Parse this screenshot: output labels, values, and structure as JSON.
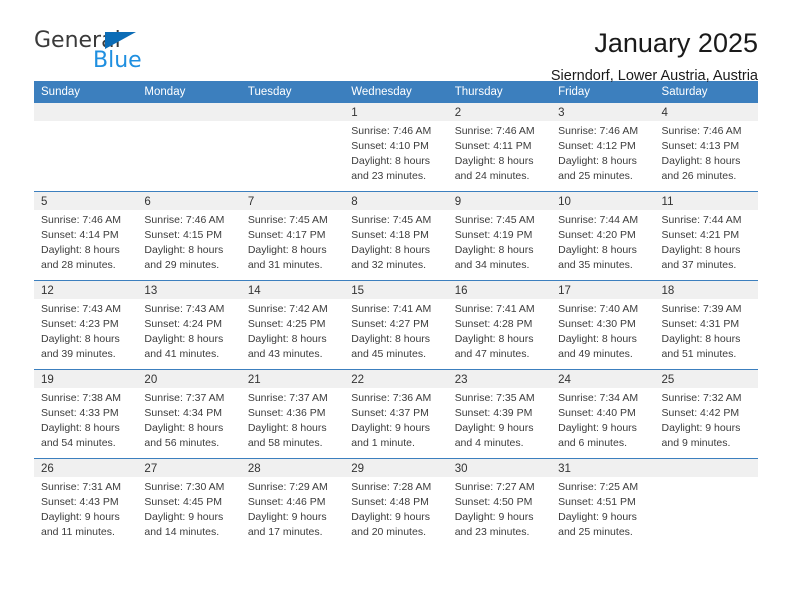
{
  "brand": {
    "name_part1": "General",
    "name_part2": "Blue",
    "accent_color": "#1f8fe0",
    "triangle_color": "#0b6cb6"
  },
  "header": {
    "title": "January 2025",
    "subtitle": "Sierndorf, Lower Austria, Austria"
  },
  "theme": {
    "header_row_bg": "#3c7fbe",
    "daynum_bg": "#f0f0f0"
  },
  "weekday_headers": [
    "Sunday",
    "Monday",
    "Tuesday",
    "Wednesday",
    "Thursday",
    "Friday",
    "Saturday"
  ],
  "weeks": [
    [
      {
        "day": "",
        "sunrise": "",
        "sunset": "",
        "daylight": "",
        "daylight2": ""
      },
      {
        "day": "",
        "sunrise": "",
        "sunset": "",
        "daylight": "",
        "daylight2": ""
      },
      {
        "day": "",
        "sunrise": "",
        "sunset": "",
        "daylight": "",
        "daylight2": ""
      },
      {
        "day": "1",
        "sunrise": "Sunrise: 7:46 AM",
        "sunset": "Sunset: 4:10 PM",
        "daylight": "Daylight: 8 hours",
        "daylight2": "and 23 minutes."
      },
      {
        "day": "2",
        "sunrise": "Sunrise: 7:46 AM",
        "sunset": "Sunset: 4:11 PM",
        "daylight": "Daylight: 8 hours",
        "daylight2": "and 24 minutes."
      },
      {
        "day": "3",
        "sunrise": "Sunrise: 7:46 AM",
        "sunset": "Sunset: 4:12 PM",
        "daylight": "Daylight: 8 hours",
        "daylight2": "and 25 minutes."
      },
      {
        "day": "4",
        "sunrise": "Sunrise: 7:46 AM",
        "sunset": "Sunset: 4:13 PM",
        "daylight": "Daylight: 8 hours",
        "daylight2": "and 26 minutes."
      }
    ],
    [
      {
        "day": "5",
        "sunrise": "Sunrise: 7:46 AM",
        "sunset": "Sunset: 4:14 PM",
        "daylight": "Daylight: 8 hours",
        "daylight2": "and 28 minutes."
      },
      {
        "day": "6",
        "sunrise": "Sunrise: 7:46 AM",
        "sunset": "Sunset: 4:15 PM",
        "daylight": "Daylight: 8 hours",
        "daylight2": "and 29 minutes."
      },
      {
        "day": "7",
        "sunrise": "Sunrise: 7:45 AM",
        "sunset": "Sunset: 4:17 PM",
        "daylight": "Daylight: 8 hours",
        "daylight2": "and 31 minutes."
      },
      {
        "day": "8",
        "sunrise": "Sunrise: 7:45 AM",
        "sunset": "Sunset: 4:18 PM",
        "daylight": "Daylight: 8 hours",
        "daylight2": "and 32 minutes."
      },
      {
        "day": "9",
        "sunrise": "Sunrise: 7:45 AM",
        "sunset": "Sunset: 4:19 PM",
        "daylight": "Daylight: 8 hours",
        "daylight2": "and 34 minutes."
      },
      {
        "day": "10",
        "sunrise": "Sunrise: 7:44 AM",
        "sunset": "Sunset: 4:20 PM",
        "daylight": "Daylight: 8 hours",
        "daylight2": "and 35 minutes."
      },
      {
        "day": "11",
        "sunrise": "Sunrise: 7:44 AM",
        "sunset": "Sunset: 4:21 PM",
        "daylight": "Daylight: 8 hours",
        "daylight2": "and 37 minutes."
      }
    ],
    [
      {
        "day": "12",
        "sunrise": "Sunrise: 7:43 AM",
        "sunset": "Sunset: 4:23 PM",
        "daylight": "Daylight: 8 hours",
        "daylight2": "and 39 minutes."
      },
      {
        "day": "13",
        "sunrise": "Sunrise: 7:43 AM",
        "sunset": "Sunset: 4:24 PM",
        "daylight": "Daylight: 8 hours",
        "daylight2": "and 41 minutes."
      },
      {
        "day": "14",
        "sunrise": "Sunrise: 7:42 AM",
        "sunset": "Sunset: 4:25 PM",
        "daylight": "Daylight: 8 hours",
        "daylight2": "and 43 minutes."
      },
      {
        "day": "15",
        "sunrise": "Sunrise: 7:41 AM",
        "sunset": "Sunset: 4:27 PM",
        "daylight": "Daylight: 8 hours",
        "daylight2": "and 45 minutes."
      },
      {
        "day": "16",
        "sunrise": "Sunrise: 7:41 AM",
        "sunset": "Sunset: 4:28 PM",
        "daylight": "Daylight: 8 hours",
        "daylight2": "and 47 minutes."
      },
      {
        "day": "17",
        "sunrise": "Sunrise: 7:40 AM",
        "sunset": "Sunset: 4:30 PM",
        "daylight": "Daylight: 8 hours",
        "daylight2": "and 49 minutes."
      },
      {
        "day": "18",
        "sunrise": "Sunrise: 7:39 AM",
        "sunset": "Sunset: 4:31 PM",
        "daylight": "Daylight: 8 hours",
        "daylight2": "and 51 minutes."
      }
    ],
    [
      {
        "day": "19",
        "sunrise": "Sunrise: 7:38 AM",
        "sunset": "Sunset: 4:33 PM",
        "daylight": "Daylight: 8 hours",
        "daylight2": "and 54 minutes."
      },
      {
        "day": "20",
        "sunrise": "Sunrise: 7:37 AM",
        "sunset": "Sunset: 4:34 PM",
        "daylight": "Daylight: 8 hours",
        "daylight2": "and 56 minutes."
      },
      {
        "day": "21",
        "sunrise": "Sunrise: 7:37 AM",
        "sunset": "Sunset: 4:36 PM",
        "daylight": "Daylight: 8 hours",
        "daylight2": "and 58 minutes."
      },
      {
        "day": "22",
        "sunrise": "Sunrise: 7:36 AM",
        "sunset": "Sunset: 4:37 PM",
        "daylight": "Daylight: 9 hours",
        "daylight2": "and 1 minute."
      },
      {
        "day": "23",
        "sunrise": "Sunrise: 7:35 AM",
        "sunset": "Sunset: 4:39 PM",
        "daylight": "Daylight: 9 hours",
        "daylight2": "and 4 minutes."
      },
      {
        "day": "24",
        "sunrise": "Sunrise: 7:34 AM",
        "sunset": "Sunset: 4:40 PM",
        "daylight": "Daylight: 9 hours",
        "daylight2": "and 6 minutes."
      },
      {
        "day": "25",
        "sunrise": "Sunrise: 7:32 AM",
        "sunset": "Sunset: 4:42 PM",
        "daylight": "Daylight: 9 hours",
        "daylight2": "and 9 minutes."
      }
    ],
    [
      {
        "day": "26",
        "sunrise": "Sunrise: 7:31 AM",
        "sunset": "Sunset: 4:43 PM",
        "daylight": "Daylight: 9 hours",
        "daylight2": "and 11 minutes."
      },
      {
        "day": "27",
        "sunrise": "Sunrise: 7:30 AM",
        "sunset": "Sunset: 4:45 PM",
        "daylight": "Daylight: 9 hours",
        "daylight2": "and 14 minutes."
      },
      {
        "day": "28",
        "sunrise": "Sunrise: 7:29 AM",
        "sunset": "Sunset: 4:46 PM",
        "daylight": "Daylight: 9 hours",
        "daylight2": "and 17 minutes."
      },
      {
        "day": "29",
        "sunrise": "Sunrise: 7:28 AM",
        "sunset": "Sunset: 4:48 PM",
        "daylight": "Daylight: 9 hours",
        "daylight2": "and 20 minutes."
      },
      {
        "day": "30",
        "sunrise": "Sunrise: 7:27 AM",
        "sunset": "Sunset: 4:50 PM",
        "daylight": "Daylight: 9 hours",
        "daylight2": "and 23 minutes."
      },
      {
        "day": "31",
        "sunrise": "Sunrise: 7:25 AM",
        "sunset": "Sunset: 4:51 PM",
        "daylight": "Daylight: 9 hours",
        "daylight2": "and 25 minutes."
      },
      {
        "day": "",
        "sunrise": "",
        "sunset": "",
        "daylight": "",
        "daylight2": ""
      }
    ]
  ]
}
